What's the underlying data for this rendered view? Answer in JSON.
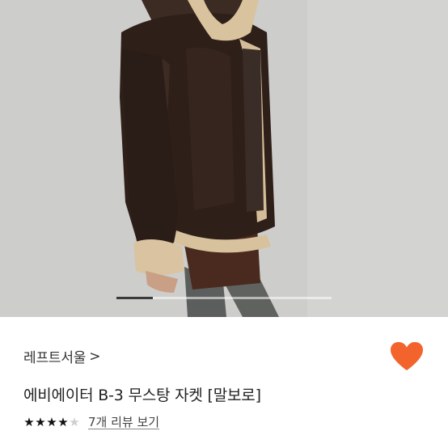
{
  "product": {
    "store_name": "레프트서울",
    "store_chevron": ">",
    "title": "에비에이터 B-3 무스탕 자켓 [말보로]",
    "rating": 4,
    "rating_max": 5,
    "reviews_link": "7개 리뷰 보기"
  },
  "gallery": {
    "current_slide": 1,
    "progress": 0.17
  },
  "colors": {
    "heart": "#f2642c",
    "star_filled": "#111111",
    "star_empty": "#cfcfcf"
  },
  "icons": {
    "wishlist": "heart-icon",
    "rating": "star-icon",
    "store_arrow": "chevron-right-icon"
  }
}
